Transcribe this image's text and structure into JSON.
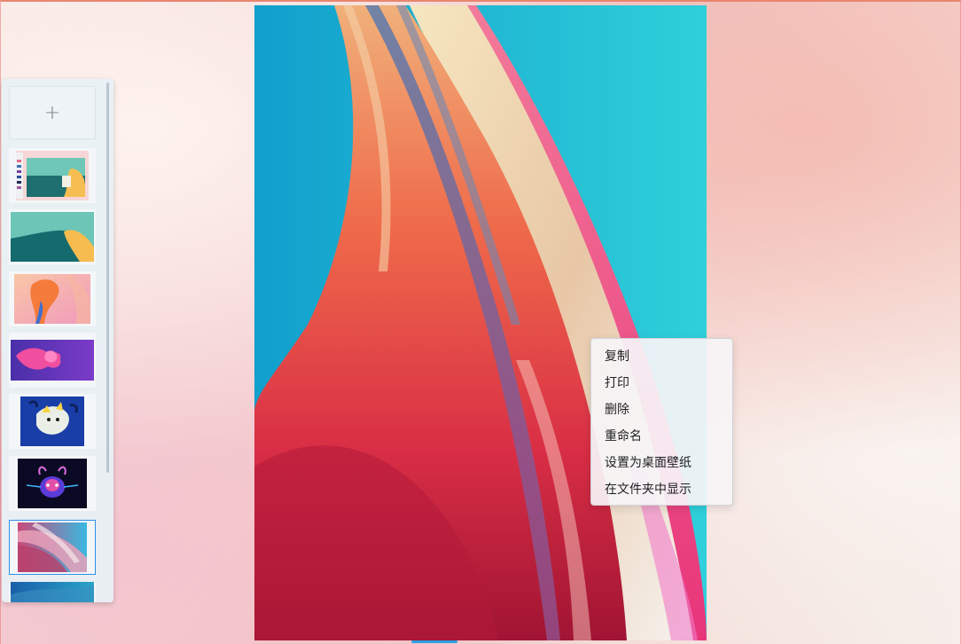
{
  "sidebar": {
    "add_button_label": "+",
    "thumbnails": [
      {
        "name": "screenshot-desktop",
        "selected": false
      },
      {
        "name": "teal-yellow-wallpaper",
        "selected": false
      },
      {
        "name": "orange-abstract-wallpaper",
        "selected": false
      },
      {
        "name": "purple-fish-wallpaper",
        "selected": false
      },
      {
        "name": "blue-dragon-wallpaper",
        "selected": false
      },
      {
        "name": "dark-neon-creature-wallpaper",
        "selected": false
      },
      {
        "name": "pink-blue-swirl-wallpaper",
        "selected": true
      },
      {
        "name": "blue-abstract-wallpaper",
        "selected": false
      }
    ]
  },
  "context_menu": {
    "items": [
      "复制",
      "打印",
      "删除",
      "重命名",
      "设置为桌面壁纸",
      "在文件夹中显示"
    ]
  },
  "colors": {
    "accent": "#2e8fe6",
    "image_bg": "#1aa3c9"
  }
}
